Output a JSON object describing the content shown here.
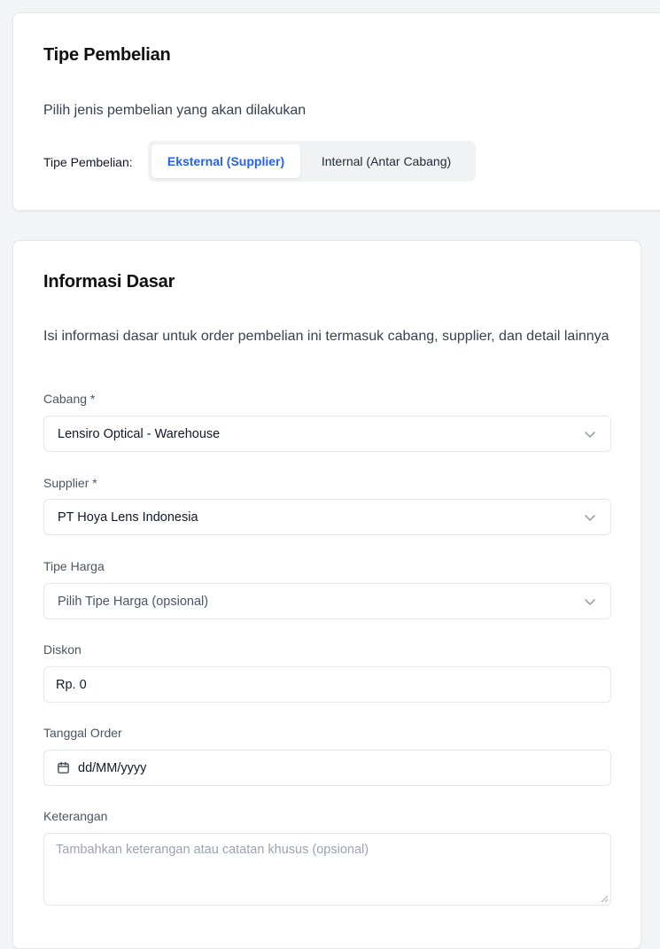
{
  "purchase_type": {
    "title": "Tipe Pembelian",
    "description": "Pilih jenis pembelian yang akan dilakukan",
    "toggle_label": "Tipe Pembelian:",
    "options": [
      {
        "label": "Eksternal (Supplier)",
        "active": true
      },
      {
        "label": "Internal (Antar Cabang)",
        "active": false
      }
    ]
  },
  "basic_info": {
    "title": "Informasi Dasar",
    "description": "Isi informasi dasar untuk order pembelian ini termasuk cabang, supplier, dan detail lainnya",
    "fields": {
      "branch": {
        "label": "Cabang *",
        "value": "Lensiro Optical - Warehouse"
      },
      "supplier": {
        "label": "Supplier *",
        "value": "PT Hoya Lens Indonesia"
      },
      "price_type": {
        "label": "Tipe Harga",
        "placeholder": "Pilih Tipe Harga (opsional)"
      },
      "discount": {
        "label": "Diskon",
        "value": "Rp. 0"
      },
      "order_date": {
        "label": "Tanggal Order",
        "value": "dd/MM/yyyy"
      },
      "notes": {
        "label": "Keterangan",
        "placeholder": "Tambahkan keterangan atau catatan khusus (opsional)"
      }
    }
  },
  "icons": {
    "dropdown": "chevron-down-icon",
    "date": "calendar-icon"
  },
  "colors": {
    "accent": "#2563eb",
    "background": "#f3f4f6",
    "card": "#ffffff",
    "border": "#e5e7eb"
  }
}
